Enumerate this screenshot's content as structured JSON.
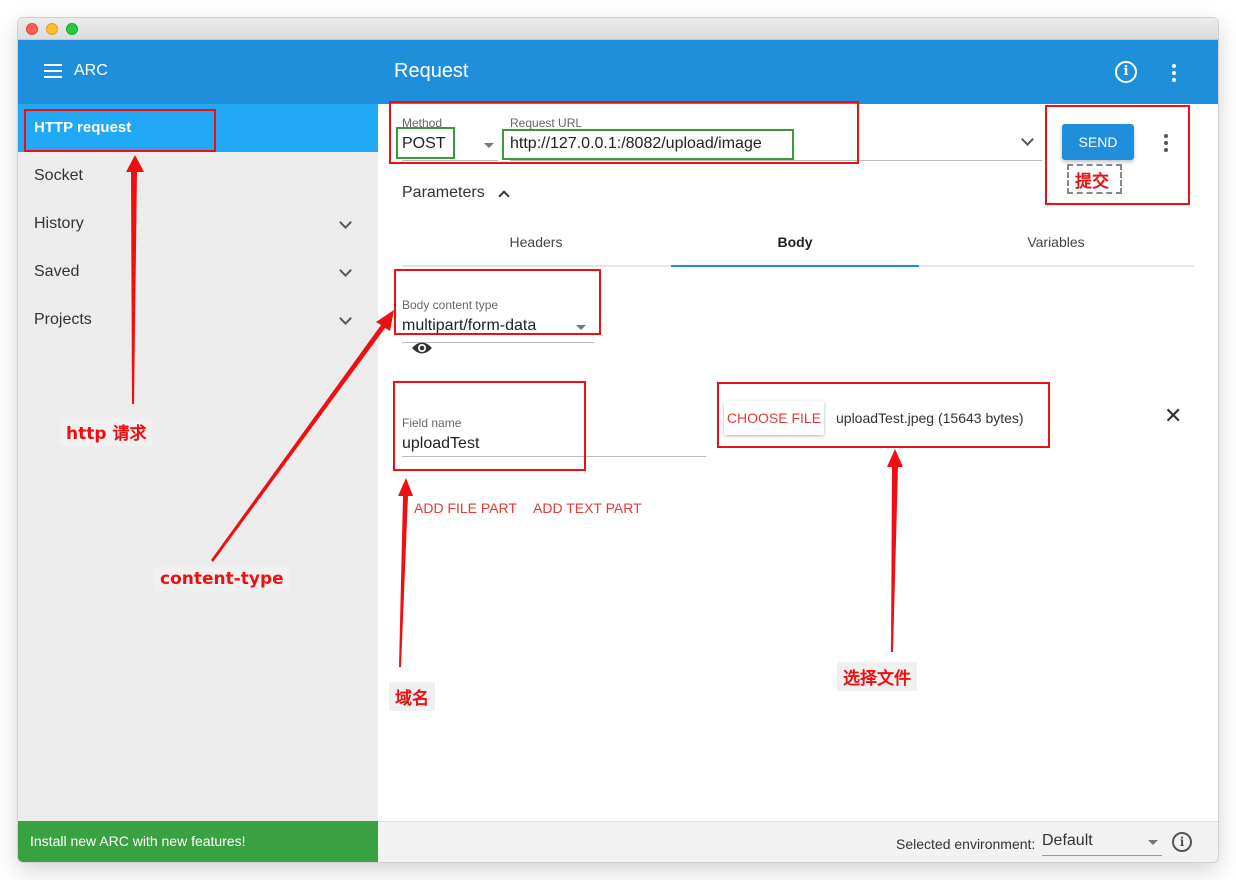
{
  "appbar": {
    "app_name": "ARC",
    "title": "Request"
  },
  "sidebar": {
    "items": [
      {
        "label": "HTTP request",
        "active": true
      },
      {
        "label": "Socket"
      },
      {
        "label": "History"
      },
      {
        "label": "Saved"
      },
      {
        "label": "Projects"
      }
    ]
  },
  "request": {
    "method_label": "Method",
    "method": "POST",
    "url_label": "Request URL",
    "url": "http://127.0.0.1:/8082/upload/image",
    "send_label": "SEND"
  },
  "params": {
    "label": "Parameters",
    "tabs": [
      {
        "label": "Headers"
      },
      {
        "label": "Body",
        "active": true
      },
      {
        "label": "Variables"
      }
    ]
  },
  "body": {
    "content_type_label": "Body content type",
    "content_type": "multipart/form-data",
    "field_name_label": "Field name",
    "field_name": "uploadTest",
    "choose_file_label": "CHOOSE FILE",
    "file_info": "uploadTest.jpeg (15643 bytes)",
    "add_file_part": "ADD FILE PART",
    "add_text_part": "ADD TEXT PART"
  },
  "footer": {
    "banner": "Install new ARC with new features!",
    "env_label": "Selected environment:",
    "env_value": "Default"
  },
  "annotations": {
    "http_request": "http 请求",
    "content_type": "content-type",
    "field_name": "域名",
    "choose_file": "选择文件",
    "submit": "提交"
  },
  "colors": {
    "accent": "#1f8fdc",
    "active_nav": "#21a9f6",
    "banner": "#3aa142",
    "annotation": "#ee1010"
  },
  "icons": [
    "menu-icon",
    "info-icon",
    "more-vert-icon",
    "chevron-down-icon",
    "chevron-up-icon",
    "eye-icon",
    "close-icon"
  ]
}
